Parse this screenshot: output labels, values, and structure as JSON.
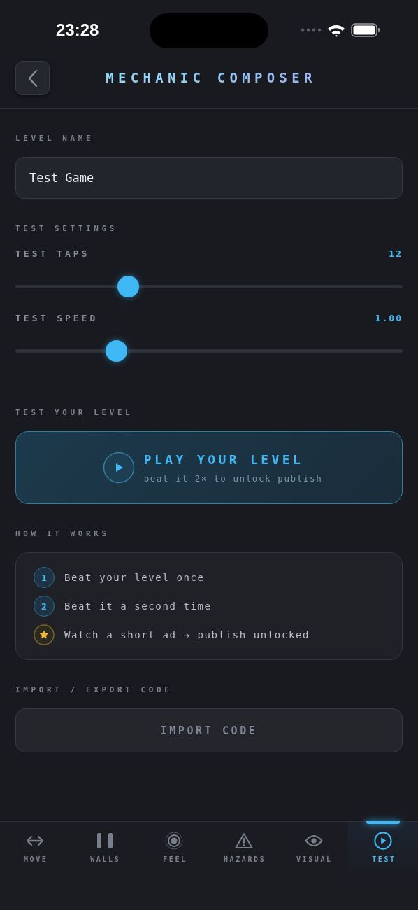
{
  "status_bar": {
    "time": "23:28"
  },
  "header": {
    "title": "MECHANIC COMPOSER"
  },
  "level_name": {
    "label": "LEVEL NAME",
    "value": "Test Game"
  },
  "test_settings": {
    "heading": "TEST SETTINGS",
    "sliders": [
      {
        "label": "TEST TAPS",
        "reading": "12",
        "level": 0.29
      },
      {
        "label": "TEST SPEED",
        "reading": "1.00",
        "level": 0.26
      }
    ]
  },
  "test_level": {
    "heading": "TEST YOUR LEVEL",
    "play_button": {
      "title": "PLAY YOUR LEVEL",
      "subtitle": "beat it 2× to unlock publish"
    }
  },
  "how_it_works": {
    "heading": "HOW IT WORKS",
    "steps": [
      {
        "kind": "number",
        "badge": "1",
        "text": "Beat your level once"
      },
      {
        "kind": "number",
        "badge": "2",
        "text": "Beat it a second time"
      },
      {
        "kind": "star",
        "text": "Watch a short ad → publish unlocked"
      }
    ]
  },
  "import_export": {
    "heading": "IMPORT / EXPORT CODE",
    "button": "IMPORT CODE"
  },
  "tab_bar": [
    {
      "kind": "move",
      "label": "MOVE",
      "selected": false
    },
    {
      "kind": "walls",
      "label": "WALLS",
      "selected": false
    },
    {
      "kind": "feel",
      "label": "FEEL",
      "selected": false
    },
    {
      "kind": "hazards",
      "label": "HAZARDS",
      "selected": false
    },
    {
      "kind": "visual",
      "label": "VISUAL",
      "selected": false
    },
    {
      "kind": "test",
      "label": "TEST",
      "selected": true
    }
  ]
}
